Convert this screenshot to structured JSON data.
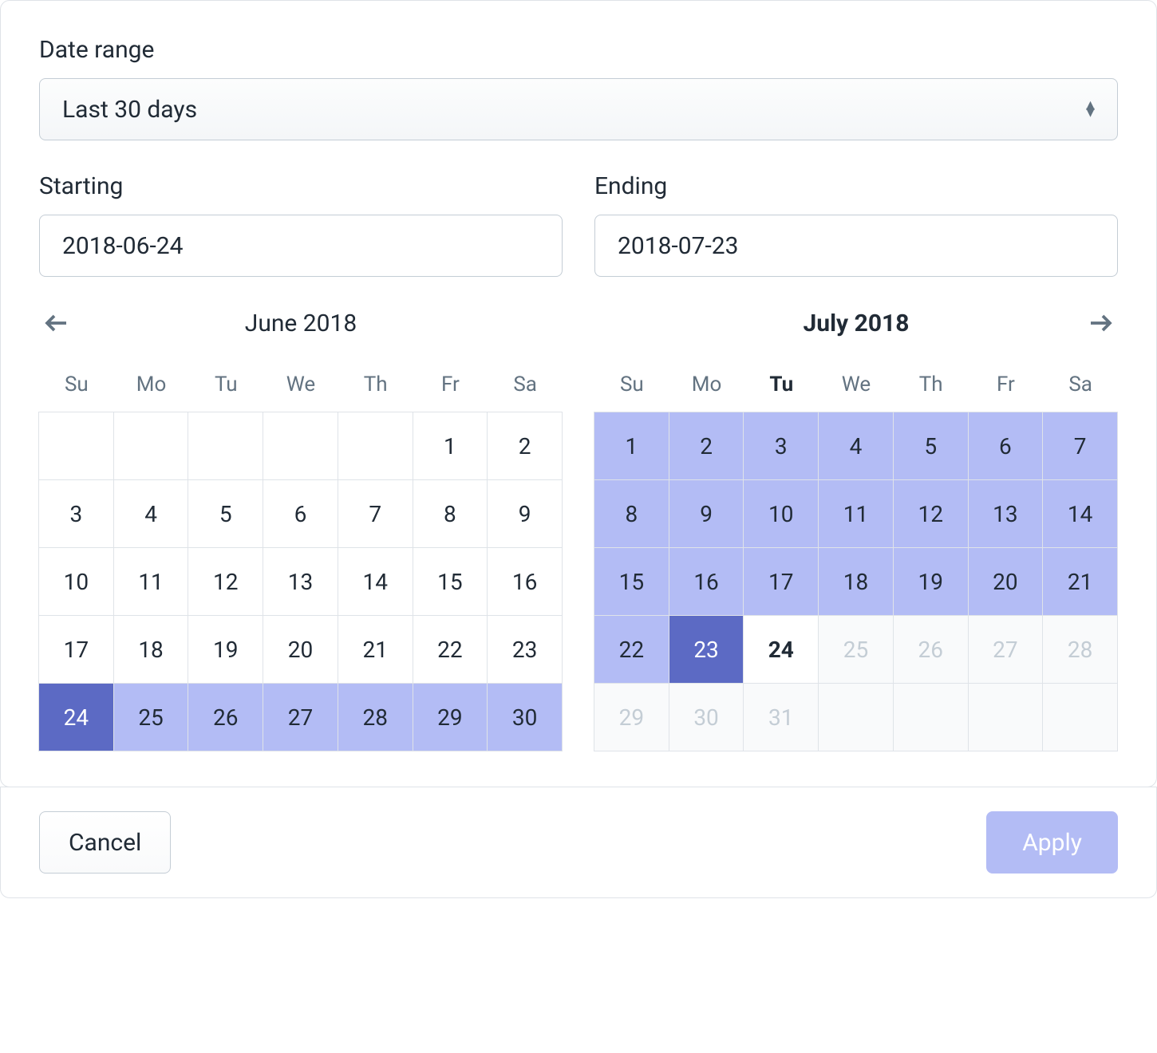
{
  "dateRangeLabel": "Date range",
  "dateRangeValue": "Last 30 days",
  "startingLabel": "Starting",
  "startingValue": "2018-06-24",
  "endingLabel": "Ending",
  "endingValue": "2018-07-23",
  "dow": [
    "Su",
    "Mo",
    "Tu",
    "We",
    "Th",
    "Fr",
    "Sa"
  ],
  "leftCal": {
    "title": "June 2018",
    "boldTitle": false,
    "boldDowIndex": -1,
    "days": [
      {
        "d": "",
        "s": "empty"
      },
      {
        "d": "",
        "s": "empty"
      },
      {
        "d": "",
        "s": "empty"
      },
      {
        "d": "",
        "s": "empty"
      },
      {
        "d": "",
        "s": "empty"
      },
      {
        "d": "1",
        "s": ""
      },
      {
        "d": "2",
        "s": ""
      },
      {
        "d": "3",
        "s": ""
      },
      {
        "d": "4",
        "s": ""
      },
      {
        "d": "5",
        "s": ""
      },
      {
        "d": "6",
        "s": ""
      },
      {
        "d": "7",
        "s": ""
      },
      {
        "d": "8",
        "s": ""
      },
      {
        "d": "9",
        "s": ""
      },
      {
        "d": "10",
        "s": ""
      },
      {
        "d": "11",
        "s": ""
      },
      {
        "d": "12",
        "s": ""
      },
      {
        "d": "13",
        "s": ""
      },
      {
        "d": "14",
        "s": ""
      },
      {
        "d": "15",
        "s": ""
      },
      {
        "d": "16",
        "s": ""
      },
      {
        "d": "17",
        "s": ""
      },
      {
        "d": "18",
        "s": ""
      },
      {
        "d": "19",
        "s": ""
      },
      {
        "d": "20",
        "s": ""
      },
      {
        "d": "21",
        "s": ""
      },
      {
        "d": "22",
        "s": ""
      },
      {
        "d": "23",
        "s": ""
      },
      {
        "d": "24",
        "s": "selected"
      },
      {
        "d": "25",
        "s": "inrange"
      },
      {
        "d": "26",
        "s": "inrange"
      },
      {
        "d": "27",
        "s": "inrange"
      },
      {
        "d": "28",
        "s": "inrange"
      },
      {
        "d": "29",
        "s": "inrange"
      },
      {
        "d": "30",
        "s": "inrange"
      }
    ]
  },
  "rightCal": {
    "title": "July 2018",
    "boldTitle": true,
    "boldDowIndex": 2,
    "days": [
      {
        "d": "1",
        "s": "inrange"
      },
      {
        "d": "2",
        "s": "inrange"
      },
      {
        "d": "3",
        "s": "inrange"
      },
      {
        "d": "4",
        "s": "inrange"
      },
      {
        "d": "5",
        "s": "inrange"
      },
      {
        "d": "6",
        "s": "inrange"
      },
      {
        "d": "7",
        "s": "inrange"
      },
      {
        "d": "8",
        "s": "inrange"
      },
      {
        "d": "9",
        "s": "inrange"
      },
      {
        "d": "10",
        "s": "inrange"
      },
      {
        "d": "11",
        "s": "inrange"
      },
      {
        "d": "12",
        "s": "inrange"
      },
      {
        "d": "13",
        "s": "inrange"
      },
      {
        "d": "14",
        "s": "inrange"
      },
      {
        "d": "15",
        "s": "inrange"
      },
      {
        "d": "16",
        "s": "inrange"
      },
      {
        "d": "17",
        "s": "inrange"
      },
      {
        "d": "18",
        "s": "inrange"
      },
      {
        "d": "19",
        "s": "inrange"
      },
      {
        "d": "20",
        "s": "inrange"
      },
      {
        "d": "21",
        "s": "inrange"
      },
      {
        "d": "22",
        "s": "inrange"
      },
      {
        "d": "23",
        "s": "selected"
      },
      {
        "d": "24",
        "s": "today"
      },
      {
        "d": "25",
        "s": "disabled"
      },
      {
        "d": "26",
        "s": "disabled"
      },
      {
        "d": "27",
        "s": "disabled"
      },
      {
        "d": "28",
        "s": "disabled"
      },
      {
        "d": "29",
        "s": "disabled"
      },
      {
        "d": "30",
        "s": "disabled"
      },
      {
        "d": "31",
        "s": "disabled"
      },
      {
        "d": "",
        "s": "disabled empty"
      },
      {
        "d": "",
        "s": "disabled empty"
      },
      {
        "d": "",
        "s": "disabled empty"
      },
      {
        "d": "",
        "s": "disabled empty"
      }
    ]
  },
  "cancelLabel": "Cancel",
  "applyLabel": "Apply"
}
